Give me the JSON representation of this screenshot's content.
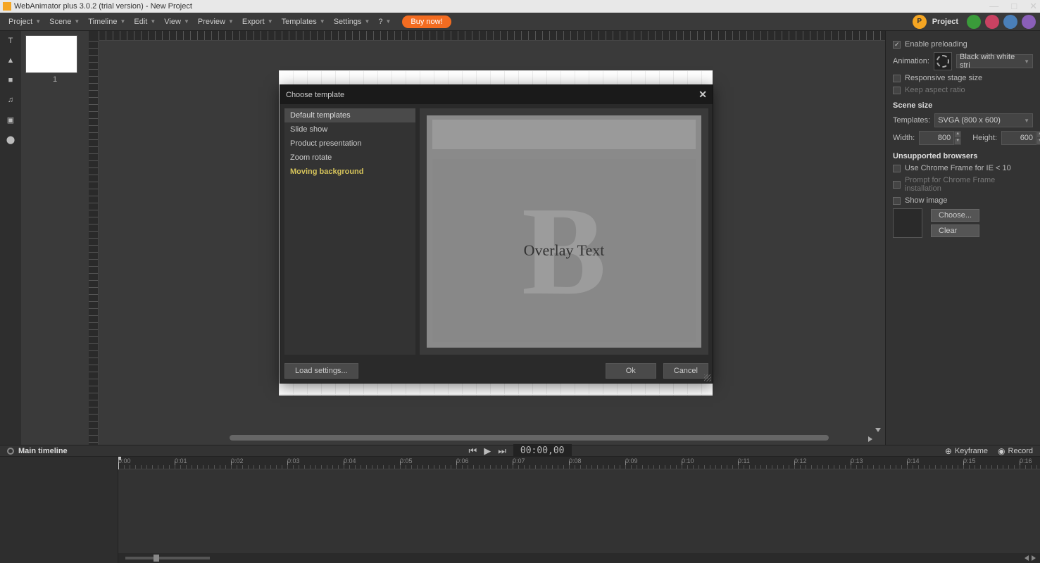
{
  "titlebar": {
    "text": "WebAnimator plus 3.0.2 (trial version) - New Project"
  },
  "menu": {
    "items": [
      "Project",
      "Scene",
      "Timeline",
      "Edit",
      "View",
      "Preview",
      "Export",
      "Templates",
      "Settings",
      "?"
    ],
    "buy": "Buy now!",
    "project_label": "Project"
  },
  "scenes": {
    "thumb1": "1"
  },
  "props": {
    "enable_preloading": "Enable preloading",
    "animation_label": "Animation:",
    "animation_value": "Black with white stri",
    "responsive": "Responsive stage size",
    "keepaspect": "Keep aspect ratio",
    "scene_size": "Scene size",
    "templates_label": "Templates:",
    "templates_value": "SVGA (800 x 600)",
    "width_label": "Width:",
    "width_value": "800",
    "height_label": "Height:",
    "height_value": "600",
    "unsupported": "Unsupported browsers",
    "chrome_frame": "Use Chrome Frame for IE < 10",
    "prompt_install": "Prompt for Chrome Frame installation",
    "show_image": "Show image",
    "choose": "Choose...",
    "clear": "Clear"
  },
  "timeline": {
    "label": "Main timeline",
    "time": "00:00,00",
    "keyframe": "Keyframe",
    "record": "Record",
    "ticks": [
      "0:00",
      "0:01",
      "0:02",
      "0:03",
      "0:04",
      "0:05",
      "0:06",
      "0:07",
      "0:08",
      "0:09",
      "0:10",
      "0:11",
      "0:12",
      "0:13",
      "0:14",
      "0:15",
      "0:16"
    ]
  },
  "modal": {
    "title": "Choose template",
    "category": "Default templates",
    "items": [
      "Slide show",
      "Product presentation",
      "Zoom rotate",
      "Moving background"
    ],
    "selected": 3,
    "overlay_text": "Overlay Text",
    "load": "Load settings...",
    "ok": "Ok",
    "cancel": "Cancel"
  }
}
